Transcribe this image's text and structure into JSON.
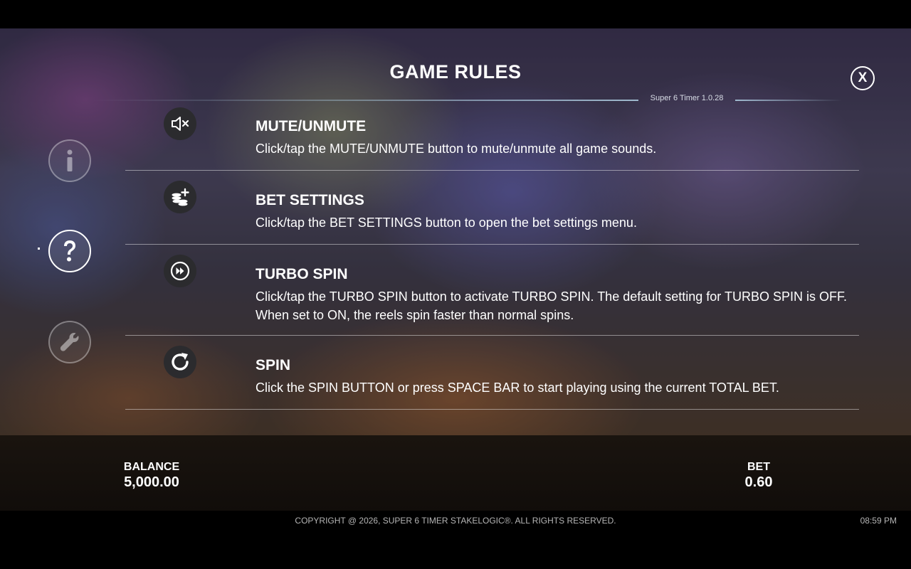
{
  "header": {
    "title": "GAME RULES",
    "version": "Super 6 Timer 1.0.28",
    "close_label": "X"
  },
  "sidebar": {
    "items": [
      {
        "name": "info",
        "icon": "info-icon",
        "active": false
      },
      {
        "name": "help",
        "icon": "question-icon",
        "active": true
      },
      {
        "name": "settings",
        "icon": "wrench-icon",
        "active": false
      }
    ]
  },
  "rules": [
    {
      "icon": "mute-icon",
      "title": "MUTE/UNMUTE",
      "description": "Click/tap the MUTE/UNMUTE button to mute/unmute all game sounds."
    },
    {
      "icon": "coins-plus-icon",
      "title": "BET SETTINGS",
      "description": "Click/tap the BET SETTINGS button to open the bet settings menu."
    },
    {
      "icon": "fast-forward-icon",
      "title": "TURBO SPIN",
      "description": "Click/tap the TURBO SPIN button to activate TURBO SPIN. The default setting for TURBO SPIN is OFF. When set to ON, the reels spin faster than normal spins."
    },
    {
      "icon": "spin-icon",
      "title": "SPIN",
      "description": "Click the SPIN BUTTON or press SPACE BAR to start playing using the current TOTAL BET."
    }
  ],
  "meters": {
    "balance_label": "BALANCE",
    "balance_value": "5,000.00",
    "bet_label": "BET",
    "bet_value": "0.60"
  },
  "footer": {
    "copyright": "COPYRIGHT @ 2026, SUPER 6 TIMER STAKELOGIC®. ALL RIGHTS RESERVED.",
    "clock": "08:59 PM"
  },
  "colors": {
    "icon_bg": "#2b2b2e",
    "divider": "#8a8a90",
    "footer_text": "#b5b5b5"
  }
}
